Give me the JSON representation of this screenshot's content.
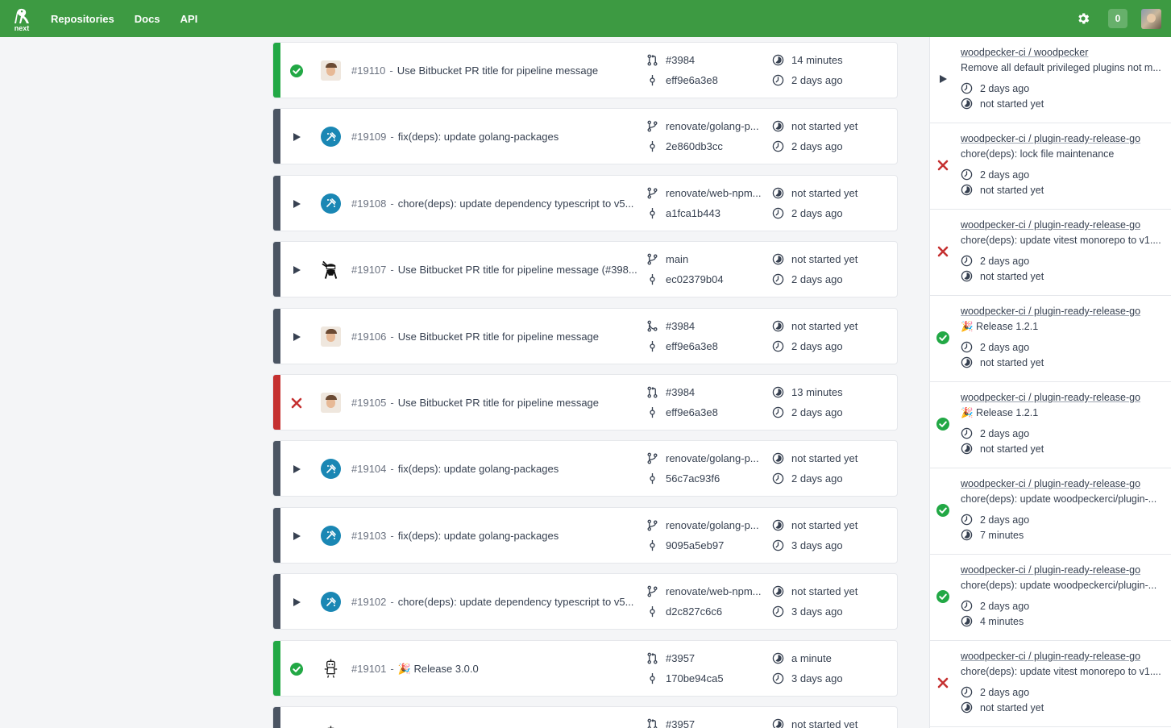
{
  "nav": {
    "logo_text": "next",
    "links": [
      "Repositories",
      "Docs",
      "API"
    ],
    "badge_count": "0"
  },
  "pipelines": [
    {
      "status": "success",
      "avatar": "person",
      "number": "#19110",
      "message": "Use Bitbucket PR title for pipeline message",
      "ref_type": "pr",
      "ref": "#3984",
      "commit": "eff9e6a3e8",
      "duration": "14 minutes",
      "since": "2 days ago"
    },
    {
      "status": "pending",
      "avatar": "renovate",
      "number": "#19109",
      "message": "fix(deps): update golang-packages",
      "ref_type": "branch",
      "ref": "renovate/golang-p...",
      "commit": "2e860db3cc",
      "duration": "not started yet",
      "since": "2 days ago"
    },
    {
      "status": "pending",
      "avatar": "renovate",
      "number": "#19108",
      "message": "chore(deps): update dependency typescript to v5...",
      "ref_type": "branch",
      "ref": "renovate/web-npm...",
      "commit": "a1fca1b443",
      "duration": "not started yet",
      "since": "2 days ago"
    },
    {
      "status": "pending",
      "avatar": "ninja",
      "number": "#19107",
      "message": "Use Bitbucket PR title for pipeline message (#398...",
      "ref_type": "branch",
      "ref": "main",
      "commit": "ec02379b04",
      "duration": "not started yet",
      "since": "2 days ago"
    },
    {
      "status": "pending",
      "avatar": "person",
      "number": "#19106",
      "message": "Use Bitbucket PR title for pipeline message",
      "ref_type": "pr-merge",
      "ref": "#3984",
      "commit": "eff9e6a3e8",
      "duration": "not started yet",
      "since": "2 days ago"
    },
    {
      "status": "failure",
      "avatar": "person",
      "number": "#19105",
      "message": "Use Bitbucket PR title for pipeline message",
      "ref_type": "pr",
      "ref": "#3984",
      "commit": "eff9e6a3e8",
      "duration": "13 minutes",
      "since": "2 days ago"
    },
    {
      "status": "pending",
      "avatar": "renovate",
      "number": "#19104",
      "message": "fix(deps): update golang-packages",
      "ref_type": "branch",
      "ref": "renovate/golang-p...",
      "commit": "56c7ac93f6",
      "duration": "not started yet",
      "since": "2 days ago"
    },
    {
      "status": "pending",
      "avatar": "renovate",
      "number": "#19103",
      "message": "fix(deps): update golang-packages",
      "ref_type": "branch",
      "ref": "renovate/golang-p...",
      "commit": "9095a5eb97",
      "duration": "not started yet",
      "since": "3 days ago"
    },
    {
      "status": "pending",
      "avatar": "renovate",
      "number": "#19102",
      "message": "chore(deps): update dependency typescript to v5...",
      "ref_type": "branch",
      "ref": "renovate/web-npm...",
      "commit": "d2c827c6c6",
      "duration": "not started yet",
      "since": "3 days ago"
    },
    {
      "status": "success",
      "avatar": "robot",
      "number": "#19101",
      "message": "🎉 Release 3.0.0",
      "ref_type": "pr",
      "ref": "#3957",
      "commit": "170be94ca5",
      "duration": "a minute",
      "since": "3 days ago"
    },
    {
      "status": "pending",
      "avatar": "robot",
      "number": "",
      "message": "",
      "ref_type": "pr",
      "ref": "#3957",
      "commit": "",
      "duration": "not started yet",
      "since": ""
    }
  ],
  "feed": [
    {
      "status": "pending",
      "repo": "woodpecker-ci / woodpecker",
      "message": "Remove all default privileged plugins not m...",
      "line1": "2 days ago",
      "line2": "not started yet"
    },
    {
      "status": "failure",
      "repo": "woodpecker-ci / plugin-ready-release-go",
      "message": "chore(deps): lock file maintenance",
      "line1": "2 days ago",
      "line2": "not started yet"
    },
    {
      "status": "failure",
      "repo": "woodpecker-ci / plugin-ready-release-go",
      "message": "chore(deps): update vitest monorepo to v1....",
      "line1": "2 days ago",
      "line2": "not started yet"
    },
    {
      "status": "success",
      "repo": "woodpecker-ci / plugin-ready-release-go",
      "message": "🎉 Release 1.2.1",
      "line1": "2 days ago",
      "line2": "not started yet"
    },
    {
      "status": "success",
      "repo": "woodpecker-ci / plugin-ready-release-go",
      "message": "🎉 Release 1.2.1",
      "line1": "2 days ago",
      "line2": "not started yet"
    },
    {
      "status": "success",
      "repo": "woodpecker-ci / plugin-ready-release-go",
      "message": "chore(deps): update woodpeckerci/plugin-...",
      "line1": "2 days ago",
      "line2": "7 minutes"
    },
    {
      "status": "success",
      "repo": "woodpecker-ci / plugin-ready-release-go",
      "message": "chore(deps): update woodpeckerci/plugin-...",
      "line1": "2 days ago",
      "line2": "4 minutes"
    },
    {
      "status": "failure",
      "repo": "woodpecker-ci / plugin-ready-release-go",
      "message": "chore(deps): update vitest monorepo to v1....",
      "line1": "2 days ago",
      "line2": "not started yet"
    }
  ],
  "colors": {
    "brand": "#3d9a42",
    "success": "#22a845",
    "failure": "#c53030",
    "pending": "#4b5563"
  }
}
